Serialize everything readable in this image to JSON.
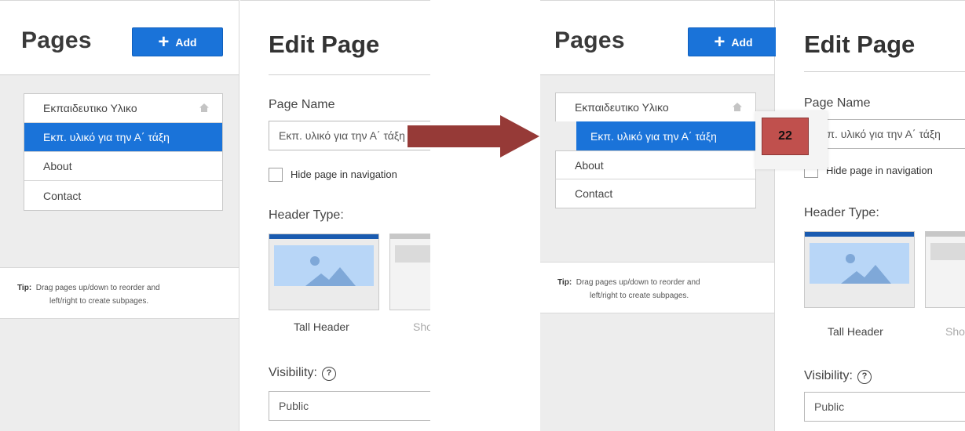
{
  "panels": [
    {
      "sidebar": {
        "title": "Pages",
        "add_label": "Add",
        "pages": [
          {
            "label": "Εκπαιδευτικο Υλικο"
          },
          {
            "label": "Εκπ. υλικό για την Α΄ τάξη"
          },
          {
            "label": "About"
          },
          {
            "label": "Contact"
          }
        ],
        "tip_label": "Tip:",
        "tip_line1": "Drag pages up/down to reorder and",
        "tip_line2": "left/right to create subpages."
      },
      "editor": {
        "title": "Edit Page",
        "page_name_label": "Page Name",
        "page_name_value": "Εκπ. υλικό για την Α΄ τάξη",
        "hide_label": "Hide page in navigation",
        "header_type_label": "Header Type:",
        "header_tall_label": "Tall Header",
        "header_short_label": "Short Header",
        "visibility_label": "Visibility:",
        "visibility_value": "Public"
      }
    }
  ],
  "annotation": {
    "badge_text": "22",
    "arrow_color": "#963a37",
    "badge_color": "#c0504d"
  },
  "colors": {
    "accent": "#1a73d9",
    "sidebar_bg": "#ededed"
  },
  "icons": [
    "plus-icon",
    "home-icon",
    "help-icon",
    "image-placeholder-icon",
    "arrow-right"
  ]
}
